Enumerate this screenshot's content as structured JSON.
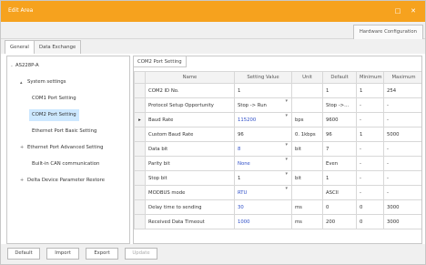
{
  "window": {
    "title": "Edit Area"
  },
  "hw_tab": "Hardware Configuration",
  "tabs": [
    "General",
    "Data Exchange"
  ],
  "tree": {
    "root": "AS228P-A",
    "items": [
      {
        "label": "System settings",
        "toggle": "▴"
      },
      {
        "label": "COM1 Port Setting",
        "toggle": ""
      },
      {
        "label": "COM2 Port Setting",
        "toggle": ""
      },
      {
        "label": "Ethernet Port Basic Setting",
        "toggle": ""
      },
      {
        "label": "Ethernet Port Advanced Setting",
        "toggle": "+"
      },
      {
        "label": "Built-in CAN communication",
        "toggle": ""
      },
      {
        "label": "Delta Device Parameter Restore",
        "toggle": "+"
      }
    ]
  },
  "panel_tab": "COM2 Port Setting",
  "table": {
    "headers": [
      "Name",
      "Setting Value",
      "Unit",
      "Default",
      "Minimum",
      "Maximum"
    ],
    "rows": [
      [
        "COM2 ID No.",
        "1",
        "",
        "1",
        "1",
        "254"
      ],
      [
        "Protocol Setup Opportunity",
        "Stop -> Run",
        "",
        "Stop ->...",
        "-",
        "-"
      ],
      [
        "Baud Rate",
        "115200",
        "bps",
        "9600",
        "-",
        "-"
      ],
      [
        "Custom Baud Rate",
        "96",
        "0. 1kbps",
        "96",
        "1",
        "5000"
      ],
      [
        "Data bit",
        "8",
        "bit",
        "7",
        "-",
        "-"
      ],
      [
        "Parity bit",
        "None",
        "",
        "Even",
        "-",
        "-"
      ],
      [
        "Stop bit",
        "1",
        "bit",
        "1",
        "-",
        "-"
      ],
      [
        "MODBUS mode",
        "RTU",
        "",
        "ASCII",
        "-",
        "-"
      ],
      [
        "Delay time to sending",
        "30",
        "ms",
        "0",
        "0",
        "3000"
      ],
      [
        "Received Data Timeout",
        "1000",
        "ms",
        "200",
        "0",
        "3000"
      ]
    ]
  },
  "buttons": {
    "default": "Default",
    "import": "Import",
    "export": "Export",
    "update": "Update"
  }
}
